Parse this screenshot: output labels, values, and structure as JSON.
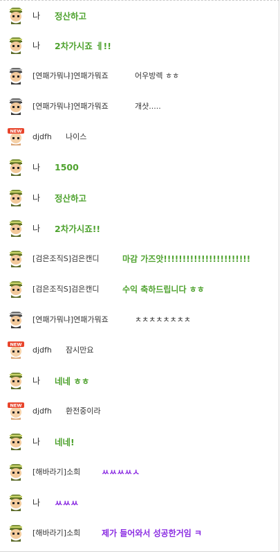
{
  "colors": {
    "my_message": "#4ea22e",
    "clan_message": "#4ea22e",
    "purple_message": "#8a2be2",
    "default_text": "#333333"
  },
  "messages": [
    {
      "sender": "나",
      "text": "정산하고",
      "avatar": "green-hair-avatar-icon"
    },
    {
      "sender": "나",
      "text": "2차가시죠 ㅔ!!",
      "avatar": "green-hair-avatar-icon"
    },
    {
      "sender": "[연패가뭐냐]연패가뭐죠",
      "text": "어우방렉 ㅎㅎ",
      "avatar": "grey-hair-avatar-icon"
    },
    {
      "sender": "[연패가뭐냐]연패가뭐죠",
      "text": "개샷.....",
      "avatar": "grey-hair-avatar-icon"
    },
    {
      "sender": "djdfh",
      "text": "나이스",
      "avatar": "new-badge-avatar-icon"
    },
    {
      "sender": "나",
      "text": "1500",
      "avatar": "green-hair-avatar-icon"
    },
    {
      "sender": "나",
      "text": "정산하고",
      "avatar": "green-hair-avatar-icon"
    },
    {
      "sender": "나",
      "text": "2차가시죠!!",
      "avatar": "green-hair-avatar-icon"
    },
    {
      "sender": "[검은조직S]검은캔디",
      "text": "마감 가즈앗!!!!!!!!!!!!!!!!!!!!!!!",
      "avatar": "green-hair-avatar-icon"
    },
    {
      "sender": "[검은조직S]검은캔디",
      "text": "수익 축하드립니다 ㅎㅎ",
      "avatar": "green-hair-avatar-icon"
    },
    {
      "sender": "[연패가뭐냐]연패가뭐죠",
      "text": "ㅊㅊㅊㅊㅊㅊㅊㅊ",
      "avatar": "grey-hair-avatar-icon"
    },
    {
      "sender": "djdfh",
      "text": "잠시만요",
      "avatar": "new-badge-avatar-icon"
    },
    {
      "sender": "나",
      "text": "네네 ㅎㅎ",
      "avatar": "green-hair-avatar-icon"
    },
    {
      "sender": "djdfh",
      "text": "환전중이라",
      "avatar": "new-badge-avatar-icon"
    },
    {
      "sender": "나",
      "text": "네네!",
      "avatar": "green-hair-avatar-icon"
    },
    {
      "sender": "[해바라기]소희",
      "text": "ㅆㅆㅆㅆㅅ",
      "avatar": "green-hair-avatar-icon"
    },
    {
      "sender": "나",
      "text": "ㅆㅆㅆ",
      "avatar": "green-hair-avatar-icon"
    },
    {
      "sender": "[해바라기]소희",
      "text": "제가 들어와서 성공한거임 ㅋ",
      "avatar": "green-hair-avatar-icon"
    }
  ]
}
